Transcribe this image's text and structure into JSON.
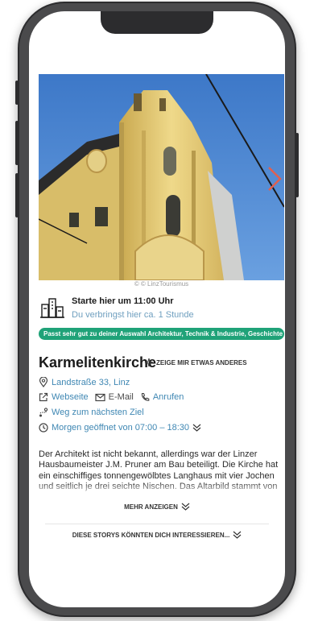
{
  "hero": {
    "caption": "© © LinzTourismus"
  },
  "start": {
    "title": "Starte hier um 11:00 Uhr",
    "subtitle": "Du verbringst hier ca. 1 Stunde"
  },
  "badge": "Passt sehr gut zu deiner Auswahl Architektur, Technik & Industrie, Geschichte ...",
  "place": {
    "name": "Karmelitenkirche",
    "other_label": "ZEIGE MIR ETWAS ANDERES",
    "address": "Landstraße 33, Linz",
    "website": "Webseite",
    "email": "E-Mail",
    "phone": "Anrufen",
    "route": "Weg zum nächsten Ziel",
    "hours": "Morgen geöffnet von 07:00 – 18:30",
    "description": "Der Architekt ist nicht bekannt, allerdings war der Linzer Hausbaumeister J.M. Pruner am Bau beteiligt. Die Kirche hat ein einschiffiges tonnengewölbtes Langhaus mit vier Jochen und seitlich je drei seichte Nischen. Das Altarbild stammt von"
  },
  "more_label": "MEHR ANZEIGEN",
  "stories_label": "DIESE STORYS KÖNNTEN DICH INTERESSIEREN...",
  "colors": {
    "accent_green": "#1fa278",
    "link_blue": "#3f87b3",
    "subtitle_blue": "#6f9fbf",
    "arrow_red": "#e06050"
  },
  "icons": [
    "city-icon",
    "sparkle-icon",
    "location-pin-icon",
    "external-link-icon",
    "mail-icon",
    "phone-icon",
    "route-icon",
    "clock-icon",
    "chevron-down-icon",
    "chevron-right-icon"
  ]
}
